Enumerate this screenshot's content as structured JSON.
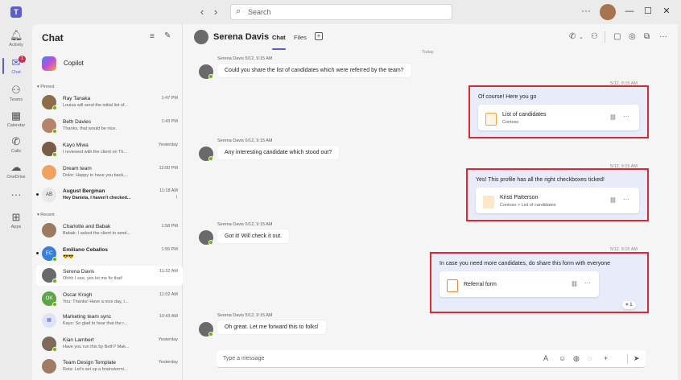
{
  "top": {
    "app_logo": "T",
    "search_placeholder": "Search",
    "more": "···",
    "win_min": "—",
    "win_max": "☐",
    "win_close": "✕"
  },
  "rail": [
    {
      "label": "Activity",
      "icon": "bell-icon"
    },
    {
      "label": "Chat",
      "icon": "chat-icon",
      "badge": "1"
    },
    {
      "label": "Teams",
      "icon": "teams-icon"
    },
    {
      "label": "Calendar",
      "icon": "calendar-icon"
    },
    {
      "label": "Calls",
      "icon": "phone-icon"
    },
    {
      "label": "OneDrive",
      "icon": "cloud-icon"
    },
    {
      "label": "",
      "icon": "more-icon"
    },
    {
      "label": "Apps",
      "icon": "apps-icon"
    }
  ],
  "chatlist": {
    "title": "Chat",
    "copilot": "Copilot",
    "pinned_label": "▾ Pinned",
    "recent_label": "▾ Recent",
    "pinned": [
      {
        "name": "Ray Tanaka",
        "preview": "Louisa will send the initial list of...",
        "time": "1:47 PM",
        "color": "#8a6d4b"
      },
      {
        "name": "Beth Davies",
        "preview": "Thanks, that would be nice.",
        "time": "1:43 PM",
        "color": "#b5836a"
      },
      {
        "name": "Kayo Miwa",
        "preview": "I reviewed with the client on Th...",
        "time": "Yesterday",
        "color": "#7a5b48"
      },
      {
        "name": "Dream team",
        "preview": "Dolor: Happy to have you back,...",
        "time": "12:00 PM",
        "color": "#f0a35e"
      },
      {
        "name": "August Bergman",
        "preview": "Hey Daniela, I haven't checked...",
        "time": "11:18 AM",
        "initials": "AB",
        "color": "#e8e8e8",
        "unread": true,
        "flag": "!"
      }
    ],
    "recent": [
      {
        "name": "Charlotte and Babak",
        "preview": "Babak: I asked the client to send...",
        "time": "1:58 PM",
        "color": "#9b7a61"
      },
      {
        "name": "Emiliano Ceballos",
        "preview": "😎😎",
        "time": "1:55 PM",
        "initials": "EC",
        "color": "#3a7fd5",
        "unread": true
      },
      {
        "name": "Serena Davis",
        "preview": "Ohhh I see, yes let me fix that!",
        "time": "11:32 AM",
        "color": "#6a6a6a",
        "selected": true
      },
      {
        "name": "Oscar Krogh",
        "preview": "You: Thanks! Have a nice day, I...",
        "time": "11:02 AM",
        "initials": "OK",
        "color": "#5fa34a"
      },
      {
        "name": "Marketing team sync",
        "preview": "Kayo: So glad to hear that the r...",
        "time": "10:43 AM",
        "color": "#dfe3f7"
      },
      {
        "name": "Kian Lambert",
        "preview": "Have you run this by Beth? Mak...",
        "time": "Yesterday",
        "color": "#7d6a5a"
      },
      {
        "name": "Team Design Template",
        "preview": "Reta: Let's set up a brainstormi...",
        "time": "Yesterday",
        "color": "#a07c62"
      }
    ]
  },
  "header": {
    "name": "Serena Davis",
    "tab_chat": "Chat",
    "tab_files": "Files",
    "tab_add": "+"
  },
  "conversation": {
    "date_stub": "Today",
    "m1": {
      "meta": "Serena Davis   5/12, 9:15 AM",
      "text": "Could you share the list of candidates which were referred by the team?"
    },
    "o1": {
      "time": "5/12, 9:15 AM",
      "text": "Of course! Here you go",
      "card_title": "List of candidates",
      "card_sub": "Contoso"
    },
    "m2": {
      "meta": "Serena Davis   5/12, 9:15 AM",
      "text": "Any interesting candidate which stood out?"
    },
    "o2": {
      "time": "5/12, 9:15 AM",
      "text": "Yes! This profile has all the right checkboxes ticked!",
      "card_title": "Kristi Patterson",
      "card_sub": "Contoso > List of candidates"
    },
    "m3": {
      "meta": "Serena Davis   5/12, 9:15 AM",
      "text": "Got it! Will check it out."
    },
    "o3": {
      "time": "5/12, 9:15 AM",
      "text": "In case you need more candidates, do share this form with everyone",
      "card_title": "Referral form",
      "reaction": "1"
    },
    "m4": {
      "meta": "Serena Davis   5/12, 9:15 AM",
      "text": "Oh great. Let me forward this to folks!"
    }
  },
  "compose": {
    "placeholder": "Type a message"
  },
  "colors": {
    "accent": "#5b5fc7",
    "outgoing_bubble": "#e8ebfa",
    "highlight_box": "#e3262d",
    "presence_available": "#6bb700"
  }
}
